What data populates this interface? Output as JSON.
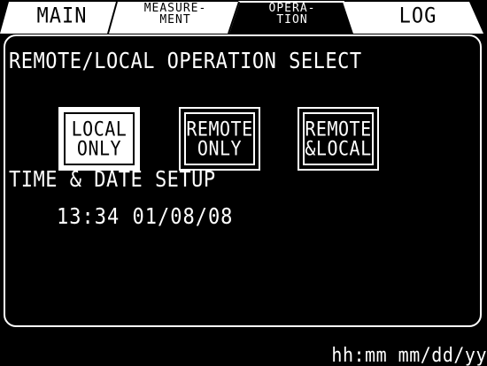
{
  "tabs": [
    {
      "label": "MAIN"
    },
    {
      "line1": "MEASURE-",
      "line2": "MENT"
    },
    {
      "line1": "OPERA-",
      "line2": "TION"
    },
    {
      "label": "LOG"
    }
  ],
  "section_operation": {
    "title": "REMOTE/LOCAL OPERATION SELECT",
    "options": [
      {
        "line1": "LOCAL",
        "line2": "ONLY",
        "selected": true
      },
      {
        "line1": "REMOTE",
        "line2": "ONLY",
        "selected": false
      },
      {
        "line1": "REMOTE",
        "line2": "&LOCAL",
        "selected": false
      }
    ]
  },
  "section_time": {
    "title": "TIME & DATE SETUP",
    "value": "13:34 01/08/08"
  },
  "status_bar": {
    "format_hint": "hh:mm mm/dd/yy"
  }
}
